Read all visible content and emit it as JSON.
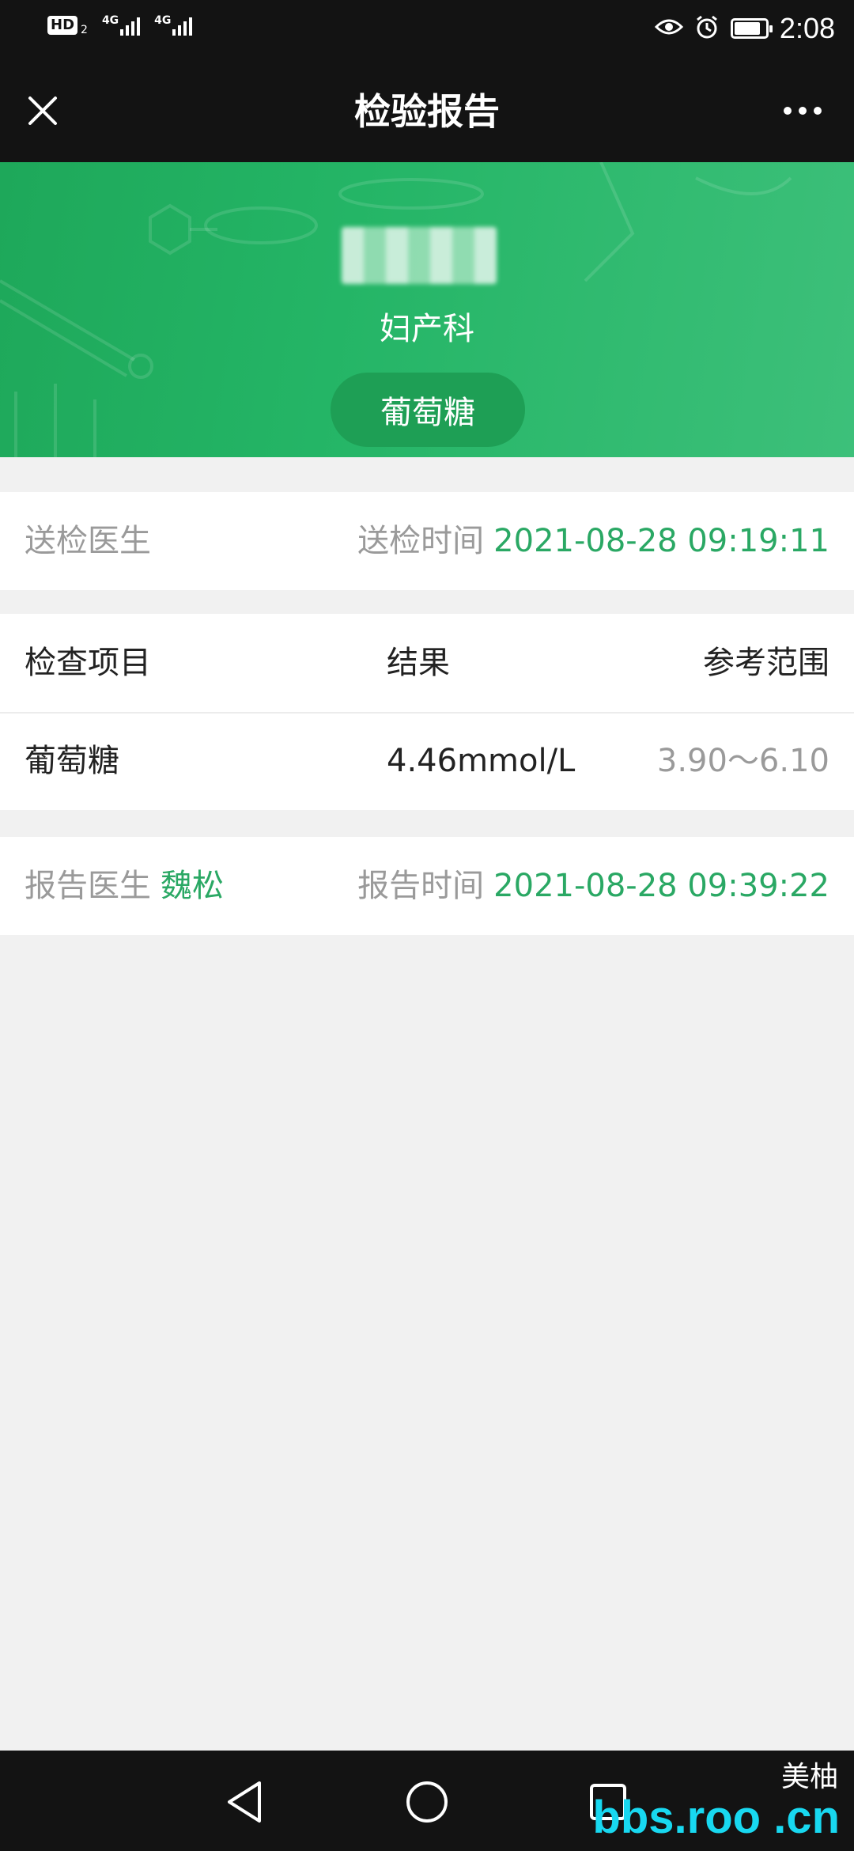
{
  "status_bar": {
    "hd": "HD",
    "hd_sub": "2",
    "network_1": "4G",
    "network_2": "4G",
    "time": "2:08",
    "battery_level": 0.85
  },
  "nav": {
    "title": "检验报告",
    "close_icon": "close-icon",
    "more_icon": "more-icon"
  },
  "banner": {
    "department": "妇产科",
    "test_name": "葡萄糖"
  },
  "send_info": {
    "doctor_label": "送检医生",
    "time_label": "送检时间",
    "time_value": "2021-08-28 09:19:11"
  },
  "results": {
    "headers": {
      "item": "检查项目",
      "result": "结果",
      "range": "参考范围"
    },
    "rows": [
      {
        "item": "葡萄糖",
        "result": "4.46mmol/L",
        "range": "3.90～6.10"
      }
    ]
  },
  "report_info": {
    "doctor_label": "报告医生",
    "doctor_value": "魏松",
    "time_label": "报告时间",
    "time_value": "2021-08-28 09:39:22"
  },
  "system_nav": {
    "back_icon": "back-triangle-icon",
    "home_icon": "home-circle-icon",
    "recent_icon": "recent-square-icon"
  },
  "watermark": {
    "text": "bbs.roo .cn",
    "brand": "美柚"
  },
  "colors": {
    "accent_green": "#2aa864",
    "banner_green": "#24b566",
    "dark_bar": "#131313",
    "background": "#f1f1f1"
  }
}
